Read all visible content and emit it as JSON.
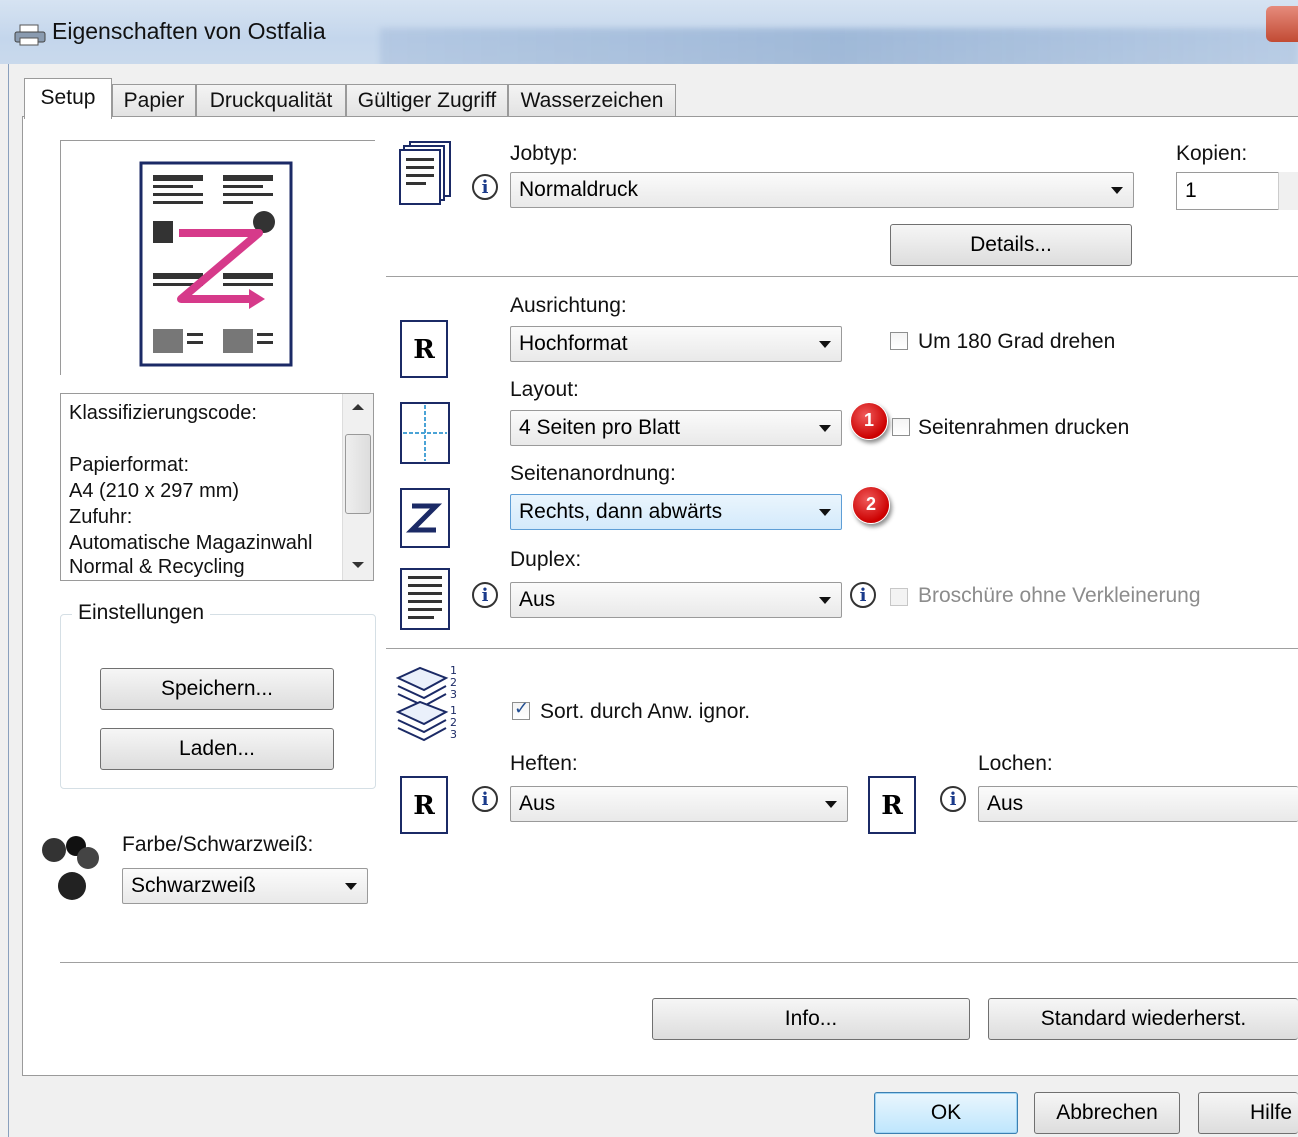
{
  "window": {
    "title": "Eigenschaften von Ostfalia"
  },
  "tabs": [
    {
      "label": "Setup",
      "active": true
    },
    {
      "label": "Papier",
      "active": false
    },
    {
      "label": "Druckqualität",
      "active": false
    },
    {
      "label": "Gültiger Zugriff",
      "active": false
    },
    {
      "label": "Wasserzeichen",
      "active": false
    }
  ],
  "info_list": {
    "lines": [
      "Klassifizierungscode:",
      "Papierformat:",
      " A4 (210 x 297 mm)",
      "Zufuhr:",
      " Automatische Magazinwahl",
      " Normal & Recycling"
    ]
  },
  "settings_group": {
    "title": "Einstellungen",
    "save_label": "Speichern...",
    "load_label": "Laden..."
  },
  "color_mode": {
    "label": "Farbe/Schwarzweiß:",
    "value": "Schwarzweiß"
  },
  "jobtype": {
    "label": "Jobtyp:",
    "value": "Normaldruck",
    "details_label": "Details..."
  },
  "copies": {
    "label": "Kopien:",
    "value": "1"
  },
  "orientation": {
    "label": "Ausrichtung:",
    "value": "Hochformat",
    "rotate_label": "Um 180 Grad drehen",
    "rotate_checked": false
  },
  "layout": {
    "label": "Layout:",
    "value": "4 Seiten pro Blatt",
    "frame_label": "Seitenrahmen drucken",
    "frame_checked": false
  },
  "page_order": {
    "label": "Seitenanordnung:",
    "value": "Rechts, dann abwärts"
  },
  "duplex": {
    "label": "Duplex:",
    "value": "Aus",
    "booklet_label": "Broschüre ohne Verkleinerung",
    "booklet_checked": false
  },
  "collate": {
    "label": "Sort. durch Anw. ignor.",
    "checked": true
  },
  "staple": {
    "label": "Heften:",
    "value": "Aus"
  },
  "punch": {
    "label": "Lochen:",
    "value": "Aus"
  },
  "bottom_buttons": {
    "info": "Info...",
    "restore": "Standard wiederherst."
  },
  "dialog_buttons": {
    "ok": "OK",
    "cancel": "Abbrechen",
    "help": "Hilfe"
  },
  "annotations": {
    "badge1": "1",
    "badge2": "2"
  },
  "icons": {
    "printer": "printer-icon",
    "document": "document-icon",
    "info": "info-icon",
    "portrait_r": "portrait-r-icon",
    "layout_grid": "layout-grid-icon",
    "z_order": "z-order-icon",
    "duplex": "duplex-page-icon",
    "collate_stack": "collate-stack-icon",
    "color_dots": "color-dots-icon"
  },
  "colors": {
    "badge": "#cc0000",
    "pink_arrow": "#d63a8a",
    "icon_blue": "#1b2a66"
  }
}
